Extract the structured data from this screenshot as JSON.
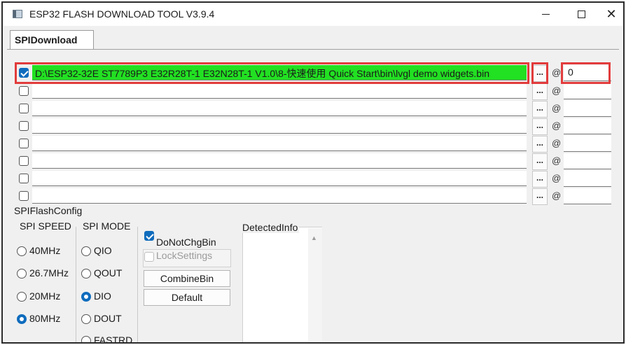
{
  "window": {
    "title": "ESP32 FLASH DOWNLOAD TOOL V3.9.4",
    "controls": [
      "—",
      "☐",
      "✕"
    ]
  },
  "tabs": [
    {
      "label": "SPIDownload",
      "active": true
    }
  ],
  "rows": [
    {
      "checked": true,
      "path": "D:\\ESP32-32E ST7789P3 E32R28T-1 E32N28T-1 V1.0\\8-快速使用 Quick Start\\bin\\lvgl demo widgets.bin",
      "browse": "...",
      "offset": "0"
    },
    {
      "checked": false,
      "path": "",
      "browse": "...",
      "offset": ""
    },
    {
      "checked": false,
      "path": "",
      "browse": "...",
      "offset": ""
    },
    {
      "checked": false,
      "path": "",
      "browse": "...",
      "offset": ""
    },
    {
      "checked": false,
      "path": "",
      "browse": "...",
      "offset": ""
    },
    {
      "checked": false,
      "path": "",
      "browse": "...",
      "offset": ""
    },
    {
      "checked": false,
      "path": "",
      "browse": "...",
      "offset": ""
    },
    {
      "checked": false,
      "path": "",
      "browse": "...",
      "offset": ""
    }
  ],
  "at_symbol": "@",
  "config": {
    "title": "SPIFlashConfig",
    "spi_speed": {
      "label": "SPI SPEED",
      "options": [
        "40MHz",
        "26.7MHz",
        "20MHz",
        "80MHz"
      ],
      "selected": "80MHz"
    },
    "spi_mode": {
      "label": "SPI MODE",
      "options": [
        "QIO",
        "QOUT",
        "DIO",
        "DOUT",
        "FASTRD"
      ],
      "selected": "DIO"
    },
    "do_not_chg_bin": {
      "label": "DoNotChgBin",
      "checked": true
    },
    "lock_settings": {
      "label": "LockSettings",
      "checked": false,
      "disabled": true
    },
    "combine_bin_label": "CombineBin",
    "default_label": "Default",
    "detected_info_label": "DetectedInfo"
  },
  "colors": {
    "highlight": "#e23c3c",
    "path_fill": "#22e022",
    "accent": "#0f6cbd"
  }
}
